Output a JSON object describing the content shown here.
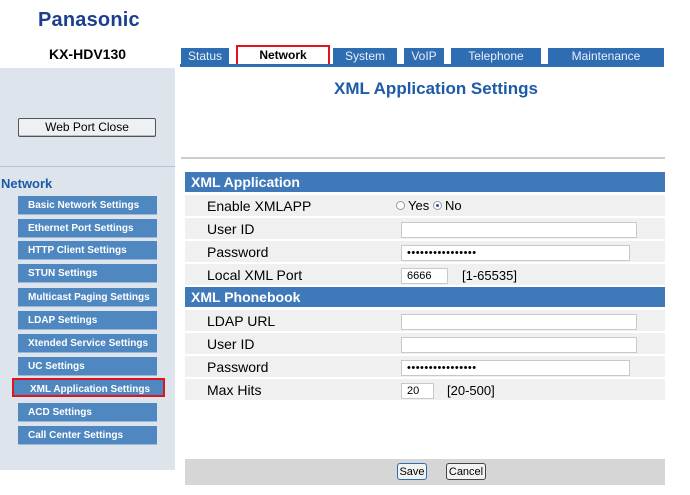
{
  "brand": {
    "logo": "Panasonic",
    "model": "KX-HDV130"
  },
  "tabs": [
    {
      "label": "Status",
      "active": false
    },
    {
      "label": "Network",
      "active": true
    },
    {
      "label": "System",
      "active": false
    },
    {
      "label": "VoIP",
      "active": false
    },
    {
      "label": "Telephone",
      "active": false
    },
    {
      "label": "Maintenance",
      "active": false
    }
  ],
  "sidebar": {
    "web_port_button": "Web Port Close",
    "section_heading": "Network",
    "items": [
      {
        "label": "Basic Network Settings"
      },
      {
        "label": "Ethernet Port Settings"
      },
      {
        "label": "HTTP Client Settings"
      },
      {
        "label": "STUN Settings"
      },
      {
        "label": "Multicast Paging Settings"
      },
      {
        "label": "LDAP Settings"
      },
      {
        "label": "Xtended Service Settings"
      },
      {
        "label": "UC Settings"
      },
      {
        "label": "XML Application Settings",
        "selected": true
      },
      {
        "label": "ACD Settings"
      },
      {
        "label": "Call Center Settings"
      }
    ]
  },
  "page": {
    "title": "XML Application Settings"
  },
  "xml_application": {
    "heading": "XML Application",
    "enable_label": "Enable XMLAPP",
    "enable_yes": "Yes",
    "enable_no": "No",
    "enable_value": "No",
    "user_id_label": "User ID",
    "user_id_value": "",
    "password_label": "Password",
    "password_value": "••••••••••••••••",
    "local_port_label": "Local XML Port",
    "local_port_value": "6666",
    "local_port_range": "[1-65535]"
  },
  "xml_phonebook": {
    "heading": "XML Phonebook",
    "ldap_url_label": "LDAP URL",
    "ldap_url_value": "",
    "user_id_label": "User ID",
    "user_id_value": "",
    "password_label": "Password",
    "password_value": "••••••••••••••••",
    "max_hits_label": "Max Hits",
    "max_hits_value": "20",
    "max_hits_range": "[20-500]"
  },
  "actions": {
    "save": "Save",
    "cancel": "Cancel"
  },
  "colors": {
    "accent": "#2f6db3",
    "highlight": "#e0141e",
    "title": "#1d5aa8"
  }
}
